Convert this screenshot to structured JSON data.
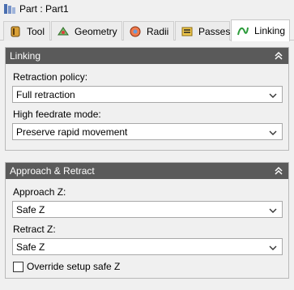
{
  "window": {
    "title": "Part : Part1",
    "icon": "part-icon"
  },
  "tabs": [
    {
      "label": "Tool",
      "icon": "tool-icon",
      "active": false
    },
    {
      "label": "Geometry",
      "icon": "geometry-icon",
      "active": false
    },
    {
      "label": "Radii",
      "icon": "radii-icon",
      "active": false
    },
    {
      "label": "Passes",
      "icon": "passes-icon",
      "active": false
    },
    {
      "label": "Linking",
      "icon": "linking-icon",
      "active": true
    }
  ],
  "linking_panel": {
    "title": "Linking",
    "retraction_policy": {
      "label": "Retraction policy:",
      "value": "Full retraction"
    },
    "high_feedrate_mode": {
      "label": "High feedrate mode:",
      "value": "Preserve rapid movement"
    }
  },
  "approach_panel": {
    "title": "Approach & Retract",
    "approach_z": {
      "label": "Approach Z:",
      "value": "Safe Z"
    },
    "retract_z": {
      "label": "Retract Z:",
      "value": "Safe Z"
    },
    "override_checkbox": {
      "label": "Override setup safe Z",
      "checked": false
    }
  },
  "colors": {
    "panel_header_bg": "#5a5a5a",
    "panel_header_text": "#ffffff",
    "window_bg": "#f0f0f0"
  }
}
